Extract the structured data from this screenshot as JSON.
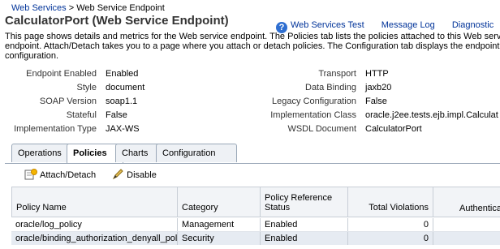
{
  "breadcrumb": {
    "parent": "Web Services",
    "separator": ">",
    "current": "Web Service Endpoint"
  },
  "page_title": "CalculatorPort (Web Service Endpoint)",
  "toplinks": {
    "test": "Web Services Test",
    "log": "Message Log",
    "diag": "Diagnostic"
  },
  "description": "This page shows details and metrics for the Web service endpoint. The Policies tab lists the policies attached to this Web service endpoint. Attach/Detach takes you to a page where you attach or detach policies. The Configuration tab displays the endpoint configuration.",
  "props_left": [
    {
      "label": "Endpoint Enabled",
      "value": "Enabled"
    },
    {
      "label": "Style",
      "value": "document"
    },
    {
      "label": "SOAP Version",
      "value": "soap1.1"
    },
    {
      "label": "Stateful",
      "value": "False"
    },
    {
      "label": "Implementation Type",
      "value": "JAX-WS"
    }
  ],
  "props_right": [
    {
      "label": "Transport",
      "value": "HTTP"
    },
    {
      "label": "Data Binding",
      "value": "jaxb20"
    },
    {
      "label": "Legacy Configuration",
      "value": "False"
    },
    {
      "label": "Implementation Class",
      "value": "oracle.j2ee.tests.ejb.impl.Calculat"
    },
    {
      "label": "WSDL Document",
      "value": "CalculatorPort"
    }
  ],
  "tabs": [
    "Operations",
    "Policies",
    "Charts",
    "Configuration"
  ],
  "toolbar": {
    "attach": "Attach/Detach",
    "disable": "Disable"
  },
  "table": {
    "headers": [
      "Policy Name",
      "Category",
      "Policy Reference Status",
      "Total Violations",
      "Authentica"
    ],
    "rows": [
      {
        "name": "oracle/log_policy",
        "category": "Management",
        "status": "Enabled",
        "violations": "0"
      },
      {
        "name": "oracle/binding_authorization_denyall_policy",
        "category": "Security",
        "status": "Enabled",
        "violations": "0"
      }
    ]
  }
}
